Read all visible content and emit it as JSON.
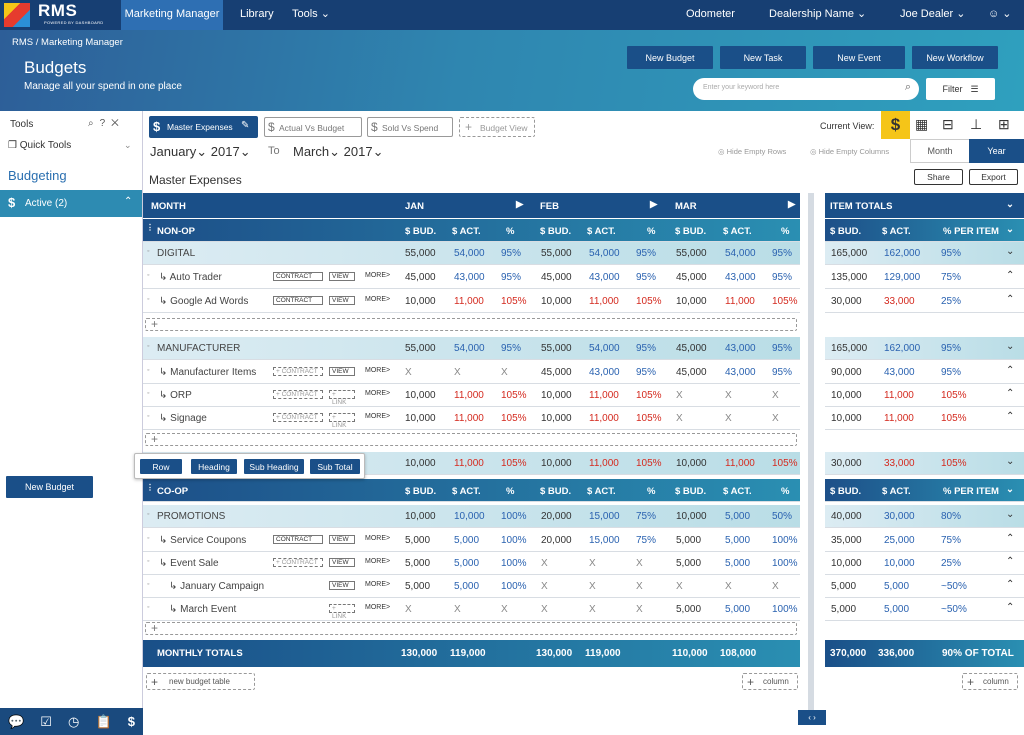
{
  "nav": {
    "logo_text": "RMS",
    "logo_sub": "POWERED BY DASHBOARD",
    "tab_active": "Marketing Manager",
    "tab_library": "Library",
    "tab_tools": "Tools",
    "odometer": "Odometer",
    "dealership": "Dealership Name",
    "user": "Joe Dealer"
  },
  "header": {
    "breadcrumb": "RMS  /  Marketing Manager",
    "title": "Budgets",
    "subtitle": "Manage all your spend in one place",
    "btn_new_budget": "New Budget",
    "btn_new_task": "New Task",
    "btn_new_event": "New Event",
    "btn_new_workflow": "New Workflow",
    "search_placeholder": "Enter your keyword here",
    "filter": "Filter"
  },
  "sidebar": {
    "tools_label": "Tools",
    "quick_tools": "Quick Tools",
    "budgeting": "Budgeting",
    "active": "Active (2)",
    "new_budget": "New Budget"
  },
  "tabs": {
    "master": "Master Expenses",
    "actual": "Actual Vs Budget",
    "sold": "Sold Vs Spend",
    "add": "Budget View",
    "current_view": "Current View:"
  },
  "period": {
    "from": "January",
    "from_year": "2017",
    "to_label": "To",
    "to": "March",
    "to_year": "2017",
    "hide_rows": "Hide Empty Rows",
    "hide_cols": "Hide Empty Columns",
    "month": "Month",
    "year": "Year"
  },
  "table": {
    "title": "Master Expenses",
    "share": "Share",
    "export": "Export",
    "month_hdr": "MONTH",
    "months": [
      "JAN",
      "FEB",
      "MAR"
    ],
    "item_totals": "ITEM TOTALS",
    "bud": "$ BUD.",
    "act": "$ ACT.",
    "pct": "%",
    "per_item": "% PER ITEM",
    "rows": [
      {
        "label": "NON-OP",
        "type": "section"
      },
      {
        "label": "DIGITAL",
        "type": "group",
        "v": [
          "55,000",
          "54,000",
          "95%",
          "55,000",
          "54,000",
          "95%",
          "55,000",
          "54,000",
          "95%"
        ],
        "t": [
          "165,000",
          "162,000",
          "95%"
        ]
      },
      {
        "label": "↳ Auto Trader",
        "type": "item",
        "tags": [
          "CONTRACT",
          "VIEW",
          "MORE>"
        ],
        "v": [
          "45,000",
          "43,000",
          "95%",
          "45,000",
          "43,000",
          "95%",
          "45,000",
          "43,000",
          "95%"
        ],
        "t": [
          "135,000",
          "129,000",
          "75%"
        ]
      },
      {
        "label": "↳ Google Ad Words",
        "type": "item",
        "tags": [
          "CONTRACT",
          "VIEW",
          "MORE>"
        ],
        "v": [
          "10,000",
          "11,000",
          "105%",
          "10,000",
          "11,000",
          "105%",
          "10,000",
          "11,000",
          "105%"
        ],
        "t": [
          "30,000",
          "33,000",
          "25%"
        ]
      },
      {
        "label": "MANUFACTURER",
        "type": "group",
        "v": [
          "55,000",
          "54,000",
          "95%",
          "55,000",
          "54,000",
          "95%",
          "45,000",
          "43,000",
          "95%"
        ],
        "t": [
          "165,000",
          "162,000",
          "95%"
        ]
      },
      {
        "label": "↳ Manufacturer Items",
        "type": "item",
        "tags": [
          "+ CONTRACT",
          "VIEW",
          "MORE>"
        ],
        "v": [
          "X",
          "X",
          "X",
          "45,000",
          "43,000",
          "95%",
          "45,000",
          "43,000",
          "95%"
        ],
        "t": [
          "90,000",
          "43,000",
          "95%"
        ]
      },
      {
        "label": "↳ ORP",
        "type": "item",
        "tags": [
          "+ CONTRACT",
          "+ LINK",
          "MORE>"
        ],
        "v": [
          "10,000",
          "11,000",
          "105%",
          "10,000",
          "11,000",
          "105%",
          "X",
          "X",
          "X"
        ],
        "t": [
          "10,000",
          "11,000",
          "105%"
        ]
      },
      {
        "label": "↳ Signage",
        "type": "item",
        "tags": [
          "+ CONTRACT",
          "+ LINK",
          "MORE>"
        ],
        "v": [
          "10,000",
          "11,000",
          "105%",
          "10,000",
          "11,000",
          "105%",
          "X",
          "X",
          "X"
        ],
        "t": [
          "10,000",
          "11,000",
          "105%"
        ]
      },
      {
        "label": "",
        "type": "subtotal",
        "v": [
          "10,000",
          "11,000",
          "105%",
          "10,000",
          "11,000",
          "105%",
          "10,000",
          "11,000",
          "105%"
        ],
        "t": [
          "30,000",
          "33,000",
          "105%"
        ]
      },
      {
        "label": "CO-OP",
        "type": "section"
      },
      {
        "label": "PROMOTIONS",
        "type": "group",
        "v": [
          "10,000",
          "10,000",
          "100%",
          "20,000",
          "15,000",
          "75%",
          "10,000",
          "5,000",
          "50%"
        ],
        "t": [
          "40,000",
          "30,000",
          "80%"
        ]
      },
      {
        "label": "↳ Service Coupons",
        "type": "item",
        "tags": [
          "CONTRACT",
          "VIEW",
          "MORE>"
        ],
        "v": [
          "5,000",
          "5,000",
          "100%",
          "20,000",
          "15,000",
          "75%",
          "5,000",
          "5,000",
          "100%"
        ],
        "t": [
          "35,000",
          "25,000",
          "75%"
        ]
      },
      {
        "label": "↳ Event Sale",
        "type": "item",
        "tags": [
          "+ CONTRACT",
          "VIEW",
          "MORE>"
        ],
        "v": [
          "5,000",
          "5,000",
          "100%",
          "X",
          "X",
          "X",
          "5,000",
          "5,000",
          "100%"
        ],
        "t": [
          "10,000",
          "10,000",
          "25%"
        ]
      },
      {
        "label": "↳ January Campaign",
        "type": "sub",
        "tags": [
          "VIEW",
          "MORE>"
        ],
        "v": [
          "5,000",
          "5,000",
          "100%",
          "X",
          "X",
          "X",
          "X",
          "X",
          "X"
        ],
        "t": [
          "5,000",
          "5,000",
          "~50%"
        ]
      },
      {
        "label": "↳ March Event",
        "type": "sub",
        "tags": [
          "+ LINK",
          "MORE>"
        ],
        "v": [
          "X",
          "X",
          "X",
          "X",
          "X",
          "X",
          "5,000",
          "5,000",
          "100%"
        ],
        "t": [
          "5,000",
          "5,000",
          "~50%"
        ]
      }
    ],
    "monthly_totals": {
      "label": "MONTHLY TOTALS",
      "v": [
        "130,000",
        "119,000",
        "",
        "130,000",
        "119,000",
        "",
        "110,000",
        "108,000",
        ""
      ],
      "t": [
        "370,000",
        "336,000",
        "90% OF TOTAL"
      ]
    },
    "new_table": "new budget table",
    "column": "column",
    "popup": [
      "Row",
      "Heading",
      "Sub Heading",
      "Sub Total"
    ]
  }
}
